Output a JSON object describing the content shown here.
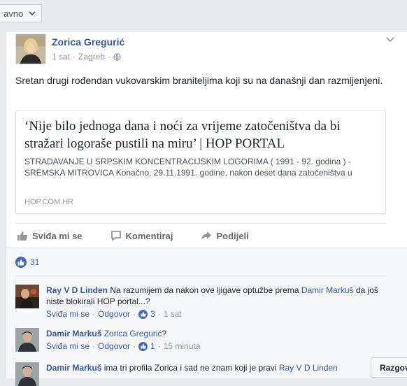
{
  "sort_button": {
    "label": "avno"
  },
  "post": {
    "author": "Zorica Gregurić",
    "time": "1 sat",
    "separator": "·",
    "location": "Zagreb",
    "location_separator": "·",
    "text": "Sretan drugi rođendan vukovarskim braniteljima koji su na današnji dan razmijenjeni.",
    "link": {
      "title": "‘Nije bilo jednoga dana i noći za vrijeme zatočeništva da bi stražari logoraše pustili na miru’ | HOP PORTAL",
      "description": "STRADAVANJE U SRPSKIM KONCENTRACIJSKIM LOGORIMA ( 1991 - 92. godina ) - SREMSKA MITROVICA   Konačno, 29.11.1991. godine, nakon deset dana zatočeništva u",
      "domain": "HOP.COM.HR"
    },
    "actions": {
      "like": "Sviđa mi se",
      "comment": "Komentiraj",
      "share": "Podijeli"
    },
    "likes_count": "31"
  },
  "comments": [
    {
      "author": "Ray V D Linden",
      "text_parts": [
        "Na razumijem da nakon ove ljigave optužbe prema ",
        "Damir Markuš",
        " da još niste blokirali HOP portal...?"
      ],
      "like_label": "Sviđa mi se",
      "reply_label": "Odgovor",
      "likes": "3",
      "time": "1 sat"
    },
    {
      "author": "Damir Markuš",
      "text_parts": [
        "Zorica Gregurić",
        "?"
      ],
      "like_label": "Sviđa mi se",
      "reply_label": "Odgovor",
      "likes": "1",
      "time": "15 minuta"
    },
    {
      "author": "Damir Markuš",
      "text_parts": [
        "ima tri profila Zorica i sad ne znam koji je pravi ",
        "Ray V D Linden"
      ]
    }
  ],
  "dot": "·",
  "chat_button": {
    "label": "Razgovor"
  },
  "colors": {
    "link_blue": "#365899",
    "like_blue": "#4267b2",
    "bg": "#e9ebee"
  }
}
